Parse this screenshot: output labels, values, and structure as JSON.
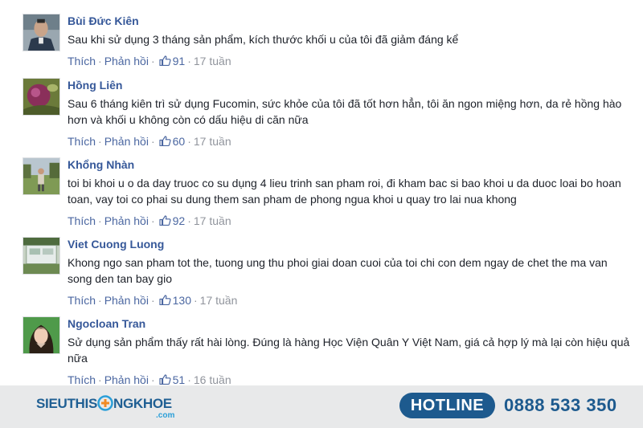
{
  "comments": [
    {
      "author": "Bùi Đức Kiên",
      "text": "Sau khi sử dụng 3 tháng sản phẩm, kích thước khối u của tôi đã giảm đáng kể",
      "like_label": "Thích",
      "reply_label": "Phản hồi",
      "likes": "91",
      "time": "17 tuần"
    },
    {
      "author": "Hồng Liên",
      "text": "Sau 6 tháng kiên trì sử dụng Fucomin, sức khỏe của tôi đã tốt hơn hẳn, tôi ăn ngon miệng hơn, da rẻ hồng hào hơn và khối u không còn có dấu hiệu di căn nữa",
      "like_label": "Thích",
      "reply_label": "Phản hồi",
      "likes": "60",
      "time": "17 tuần"
    },
    {
      "author": "Khổng Nhàn",
      "text": "toi bi khoi u o da day truoc co su dụng 4 lieu trinh san pham roi, đi kham bac si bao khoi u da duoc loai bo hoan toan, vay toi co phai su dung them san pham de phong ngua khoi u quay tro lai nua khong",
      "like_label": "Thích",
      "reply_label": "Phản hồi",
      "likes": "92",
      "time": "17 tuần"
    },
    {
      "author": "Viet Cuong Luong",
      "text": "Khong ngo san pham tot the, tuong ung thu phoi giai doan cuoi của toi chi con dem ngay de chet the ma van song den tan bay gio",
      "like_label": "Thích",
      "reply_label": "Phản hồi",
      "likes": "130",
      "time": "17 tuần"
    },
    {
      "author": "Ngocloan Tran",
      "text": "Sử dụng sản phẩm thấy rất hài lòng. Đúng là hàng Học Viện Quân Y Việt Nam, giá cả hợp lý mà lại còn hiệu quả nữa",
      "like_label": "Thích",
      "reply_label": "Phản hồi",
      "likes": "51",
      "time": "16 tuần"
    }
  ],
  "footer": {
    "logo_left": "SIEUTHIS",
    "logo_right": "NGKHOE",
    "logo_domain": ".com",
    "hotline_label": "HOTLINE",
    "phone": "0888 533 350"
  },
  "colors": {
    "author": "#365899",
    "link": "#4b67a1",
    "meta": "#90949c",
    "footer_bg": "#e8e9ea",
    "brand": "#1d5a8e"
  },
  "icons": {
    "like": "thumbs-up-icon"
  }
}
